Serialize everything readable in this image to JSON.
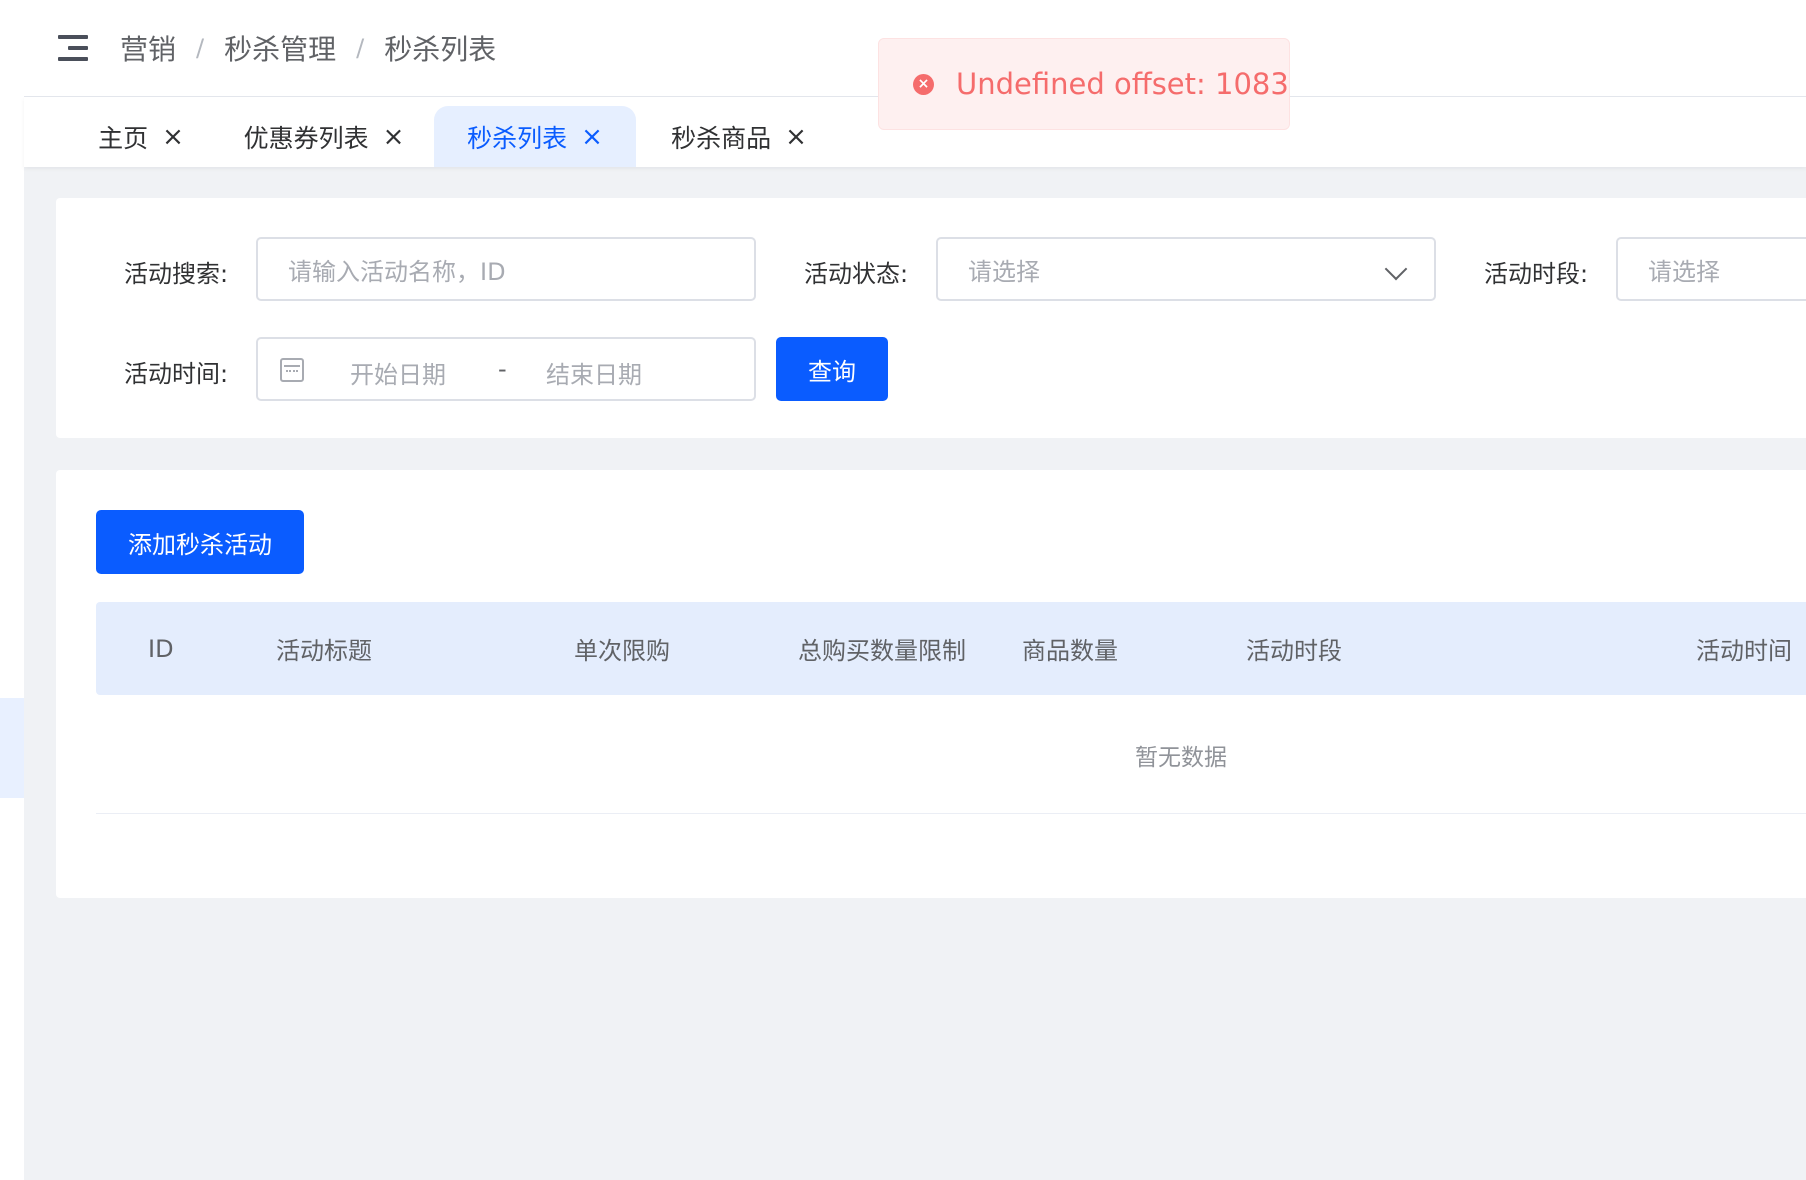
{
  "breadcrumb": [
    "营销",
    "秒杀管理",
    "秒杀列表"
  ],
  "breadcrumb_separator": "/",
  "toast": {
    "type": "error",
    "message": "Undefined offset: 1083"
  },
  "tabs": [
    {
      "label": "主页",
      "active": false
    },
    {
      "label": "优惠券列表",
      "active": false
    },
    {
      "label": "秒杀列表",
      "active": true
    },
    {
      "label": "秒杀商品",
      "active": false
    }
  ],
  "filters": {
    "search_label": "活动搜索:",
    "search_placeholder": "请输入活动名称，ID",
    "status_label": "活动状态:",
    "status_placeholder": "请选择",
    "period_label": "活动时段:",
    "period_placeholder": "请选择",
    "time_label": "活动时间:",
    "start_placeholder": "开始日期",
    "range_separator": "-",
    "end_placeholder": "结束日期",
    "query_button": "查询"
  },
  "table": {
    "add_button": "添加秒杀活动",
    "columns": [
      "ID",
      "活动标题",
      "单次限购",
      "总购买数量限制",
      "商品数量",
      "活动时段",
      "活动时间"
    ],
    "empty_text": "暂无数据"
  },
  "colors": {
    "primary": "#0a5cff",
    "error": "#f56c6c",
    "table_header_bg": "#e4edfd"
  }
}
